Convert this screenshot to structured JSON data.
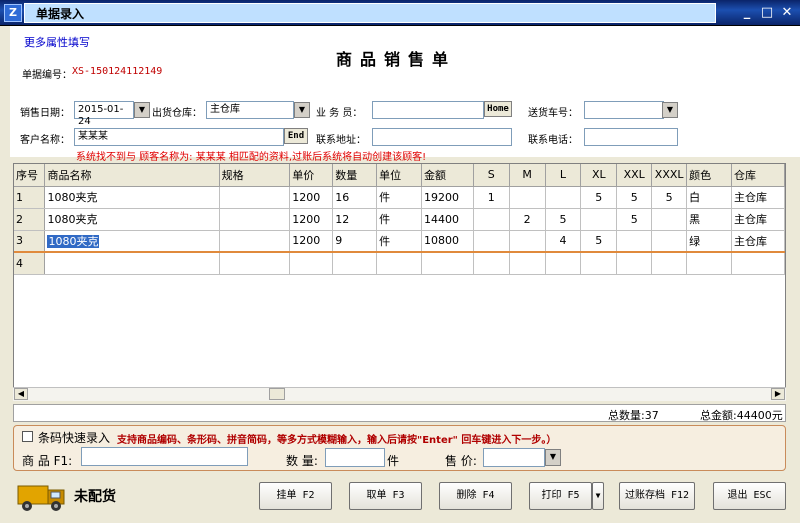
{
  "window": {
    "title": "单据录入",
    "minimize": "_",
    "restore": "□",
    "close": "✕"
  },
  "form": {
    "more_link": "更多属性填写",
    "doc_title": "商品销售单",
    "doc_no_label": "单据编号：",
    "doc_no": "XS-150124112149",
    "date_label": "销售日期：",
    "date_value": "2015-01-24",
    "warehouse_label": "出货仓库：",
    "warehouse_value": "主仓库",
    "salesman_label": "业 务 员：",
    "salesman_value": "",
    "home_btn": "Home",
    "delivery_label": "送货车号：",
    "delivery_value": "",
    "customer_label": "客户名称：",
    "customer_value": "某某某",
    "end_btn": "End",
    "address_label": "联系地址：",
    "address_value": "",
    "phone_label": "联系电话：",
    "phone_value": "",
    "warning": "系统找不到与 顾客名称为: 某某某 相匹配的资料,过账后系统将自动创建该顾客!"
  },
  "grid": {
    "headers": [
      "序号",
      "商品名称",
      "规格",
      "单价",
      "数量",
      "单位",
      "金额",
      "S",
      "M",
      "L",
      "XL",
      "XXL",
      "XXXL",
      "颜色",
      "仓库"
    ],
    "rows": [
      [
        "1",
        "1080夹克",
        "",
        "1200",
        "16",
        "件",
        "19200",
        "1",
        "",
        "",
        "5",
        "5",
        "5",
        "白",
        "主仓库"
      ],
      [
        "2",
        "1080夹克",
        "",
        "1200",
        "12",
        "件",
        "14400",
        "",
        "2",
        "5",
        "",
        "5",
        "",
        "黑",
        "主仓库"
      ],
      [
        "3",
        "1080夹克",
        "",
        "1200",
        "9",
        "件",
        "10800",
        "",
        "",
        "4",
        "5",
        "",
        "",
        "绿",
        "主仓库"
      ],
      [
        "4",
        "",
        "",
        "",
        "",
        "",
        "",
        "",
        "",
        "",
        "",
        "",
        "",
        "",
        ""
      ]
    ],
    "total_qty": "总数量:37",
    "total_amount": "总金额:44400元"
  },
  "quick": {
    "checkbox_label": "条码快速录入",
    "hint": "支持商品编码、条形码、拼音简码，等多方式模糊输入，输入后请按\"Enter\" 回车键进入下一步。）",
    "product_label": "商 品 F1:",
    "product_value": "",
    "qty_label": "数 量:",
    "qty_value": "",
    "qty_unit": "件",
    "price_label": "售 价:",
    "price_value": ""
  },
  "status": {
    "text": "未配货"
  },
  "buttons": {
    "hold": "挂单 F2",
    "retrieve": "取单 F3",
    "delete": "删除 F4",
    "print": "打印 F5",
    "post": "过账存档 F12",
    "exit": "退出 ESC"
  },
  "colors": {
    "titlebar": "#0a246a",
    "warning": "#e00000",
    "docno": "#c00000",
    "active_row_line": "#e08a3c"
  }
}
